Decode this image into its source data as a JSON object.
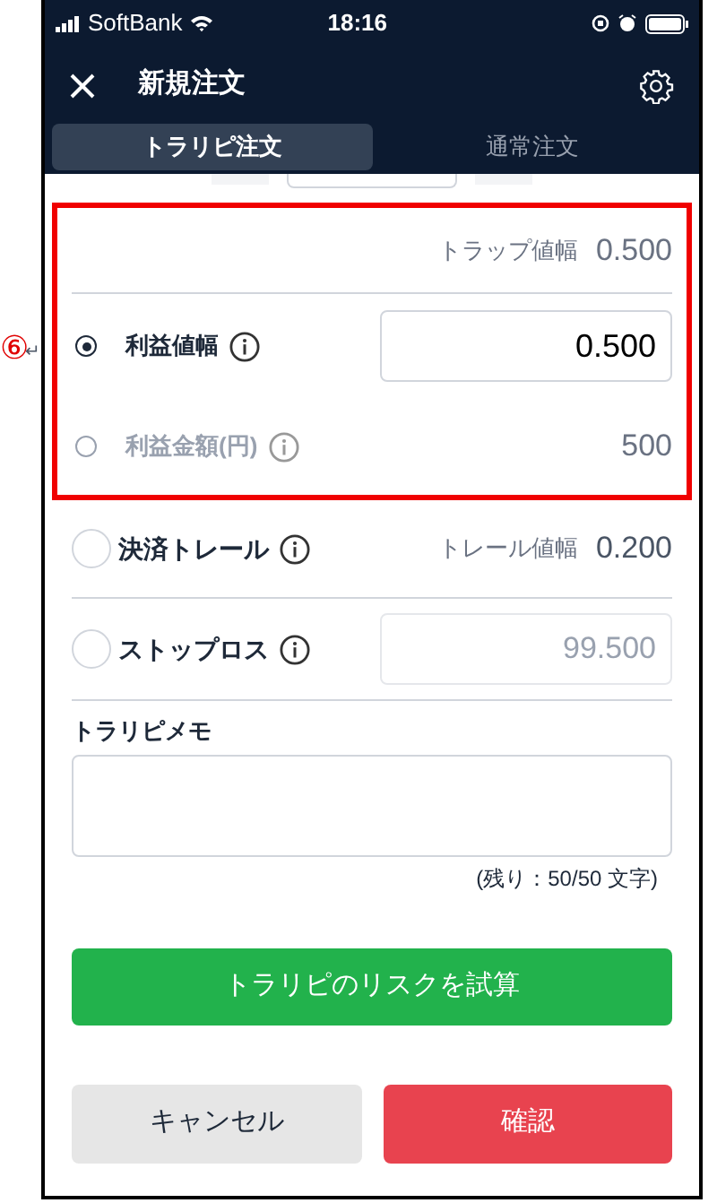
{
  "annotation": {
    "marker": "⑥",
    "return_mark": "↵"
  },
  "status_bar": {
    "carrier": "SoftBank",
    "time": "18:16"
  },
  "header": {
    "title": "新規注文"
  },
  "tabs": [
    {
      "label": "トラリピ注文",
      "selected": true
    },
    {
      "label": "通常注文",
      "selected": false
    }
  ],
  "trap": {
    "label": "トラップ値幅",
    "value": "0.500"
  },
  "profit_options": [
    {
      "label": "利益値幅",
      "selected": true,
      "kind": "input",
      "value": "0.500"
    },
    {
      "label": "利益金額(円)",
      "selected": false,
      "kind": "text",
      "value": "500"
    }
  ],
  "trail": {
    "label": "決済トレール",
    "checked": false,
    "value_label": "トレール値幅",
    "value": "0.200"
  },
  "stop_loss": {
    "label": "ストップロス",
    "checked": false,
    "value": "99.500"
  },
  "memo": {
    "label": "トラリピメモ",
    "counter": "(残り：50/50 文字)"
  },
  "risk_button": "トラリピのリスクを試算",
  "buttons": [
    {
      "label": "キャンセル",
      "kind": "cancel"
    },
    {
      "label": "確認",
      "kind": "confirm"
    }
  ]
}
